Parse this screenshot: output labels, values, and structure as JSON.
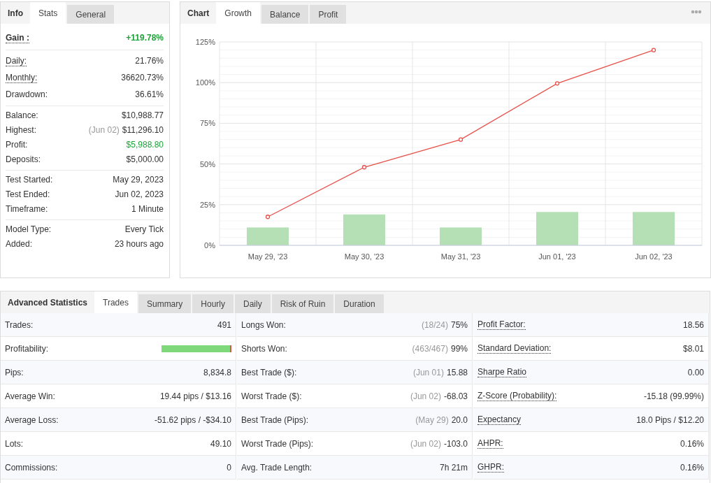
{
  "stats_panel": {
    "heading": "Info",
    "tabs": [
      {
        "label": "Stats",
        "selected": true
      },
      {
        "label": "General",
        "selected": false
      }
    ],
    "groups": [
      {
        "rows": [
          {
            "label": "Gain :",
            "value": "+119.78%",
            "dotted": true,
            "emphasis": true,
            "positive": true
          }
        ]
      },
      {
        "rows": [
          {
            "label": "Daily:",
            "value": "21.76%",
            "dotted": true,
            "positive": false
          },
          {
            "label": "Monthly:",
            "value": "36620.73%",
            "dotted": true,
            "positive": false
          },
          {
            "label": "Drawdown:",
            "value": "36.61%",
            "dotted": false,
            "positive": false
          }
        ]
      },
      {
        "rows": [
          {
            "label": "Balance:",
            "value": "$10,988.77",
            "dotted": false,
            "positive": false
          },
          {
            "label": "Highest:",
            "note": "(Jun 02)",
            "value": "$11,296.10",
            "dotted": false,
            "positive": false
          },
          {
            "label": "Profit:",
            "value": "$5,988.80",
            "dotted": false,
            "positive": true
          },
          {
            "label": "Deposits:",
            "value": "$5,000.00",
            "dotted": false,
            "positive": false
          }
        ]
      },
      {
        "rows": [
          {
            "label": "Test Started:",
            "value": "May 29, 2023",
            "dotted": false,
            "positive": false
          },
          {
            "label": "Test Ended:",
            "value": "Jun 02, 2023",
            "dotted": false,
            "positive": false
          },
          {
            "label": "Timeframe:",
            "value": "1 Minute",
            "dotted": false,
            "positive": false
          }
        ]
      },
      {
        "rows": [
          {
            "label": "Model Type:",
            "value": "Every Tick",
            "dotted": false,
            "positive": false
          },
          {
            "label": "Added:",
            "value": "23 hours ago",
            "dotted": false,
            "positive": false
          }
        ]
      }
    ]
  },
  "chart_panel": {
    "heading": "Chart",
    "tabs": [
      {
        "label": "Growth",
        "selected": true
      },
      {
        "label": "Balance",
        "selected": false
      },
      {
        "label": "Profit",
        "selected": false
      }
    ],
    "chart_data": {
      "type": "bar",
      "grid": true,
      "categories": [
        "May 29, '23",
        "May 30, '23",
        "May 31, '23",
        "Jun 01, '23",
        "Jun 02, '23"
      ],
      "series": [
        {
          "color": "#b5dfb5",
          "values": [
            11,
            19,
            11,
            20.5,
            20.5
          ]
        },
        {
          "type": "line",
          "marker": true,
          "color": "#e8504a",
          "values": [
            17.5,
            48,
            65,
            99.5,
            120
          ]
        }
      ],
      "ylim": [
        0,
        125
      ],
      "yticks": [
        {
          "value": 0,
          "label": "0%"
        },
        {
          "value": 25,
          "label": "25%"
        },
        {
          "value": 50,
          "label": "50%"
        },
        {
          "value": 75,
          "label": "75%"
        },
        {
          "value": 100,
          "label": "100%"
        },
        {
          "value": 125,
          "label": "125%"
        }
      ]
    }
  },
  "advanced_panel": {
    "heading": "Advanced Statistics",
    "tabs": [
      {
        "label": "Trades",
        "selected": true
      },
      {
        "label": "Summary",
        "selected": false
      },
      {
        "label": "Hourly",
        "selected": false
      },
      {
        "label": "Daily",
        "selected": false
      },
      {
        "label": "Risk of Ruin",
        "selected": false
      },
      {
        "label": "Duration",
        "selected": false
      }
    ],
    "columns": [
      {
        "rows": [
          {
            "kind": "text",
            "label": "Trades:",
            "value": "491",
            "dotted": false
          },
          {
            "kind": "bar",
            "label": "Profitability:",
            "level": 0.98,
            "dotted": false
          },
          {
            "kind": "text",
            "label": "Pips:",
            "value": "8,834.8",
            "dotted": false
          },
          {
            "kind": "text",
            "label": "Average Win:",
            "value": "19.44 pips / $13.16",
            "dotted": false
          },
          {
            "kind": "text",
            "label": "Average Loss:",
            "value": "-51.62 pips / -$34.10",
            "dotted": false
          },
          {
            "kind": "text",
            "label": "Lots:",
            "value": "49.10",
            "dotted": false
          },
          {
            "kind": "text",
            "label": "Commissions:",
            "value": "0",
            "dotted": false
          }
        ]
      },
      {
        "rows": [
          {
            "kind": "text",
            "label": "Longs Won:",
            "note": "(18/24)",
            "value": "75%",
            "dotted": false
          },
          {
            "kind": "text",
            "label": "Shorts Won:",
            "note": "(463/467)",
            "value": "99%",
            "dotted": false
          },
          {
            "kind": "text",
            "label": "Best Trade ($):",
            "note": "(Jun 01)",
            "value": "15.88",
            "dotted": false
          },
          {
            "kind": "text",
            "label": "Worst Trade ($):",
            "note": "(Jun 02)",
            "value": "-68.03",
            "dotted": false
          },
          {
            "kind": "text",
            "label": "Best Trade (Pips):",
            "note": "(May 29)",
            "value": "20.0",
            "dotted": false
          },
          {
            "kind": "text",
            "label": "Worst Trade (Pips):",
            "note": "(Jun 02)",
            "value": "-103.0",
            "dotted": false
          },
          {
            "kind": "text",
            "label": "Avg. Trade Length:",
            "value": "7h 21m",
            "dotted": false
          }
        ]
      },
      {
        "rows": [
          {
            "kind": "text",
            "label": "Profit Factor:",
            "value": "18.56",
            "dotted": true
          },
          {
            "kind": "text",
            "label": "Standard Deviation:",
            "value": "$8.01",
            "dotted": true
          },
          {
            "kind": "text",
            "label": "Sharpe Ratio",
            "value": "0.00",
            "dotted": true
          },
          {
            "kind": "text",
            "label": "Z-Score (Probability):",
            "value": "-15.18 (99.99%)",
            "dotted": true
          },
          {
            "kind": "text",
            "label": "Expectancy",
            "value": "18.0 Pips / $12.20",
            "dotted": true
          },
          {
            "kind": "text",
            "label": "AHPR:",
            "value": "0.16%",
            "dotted": true
          },
          {
            "kind": "text",
            "label": "GHPR:",
            "value": "0.16%",
            "dotted": true
          }
        ]
      }
    ]
  }
}
